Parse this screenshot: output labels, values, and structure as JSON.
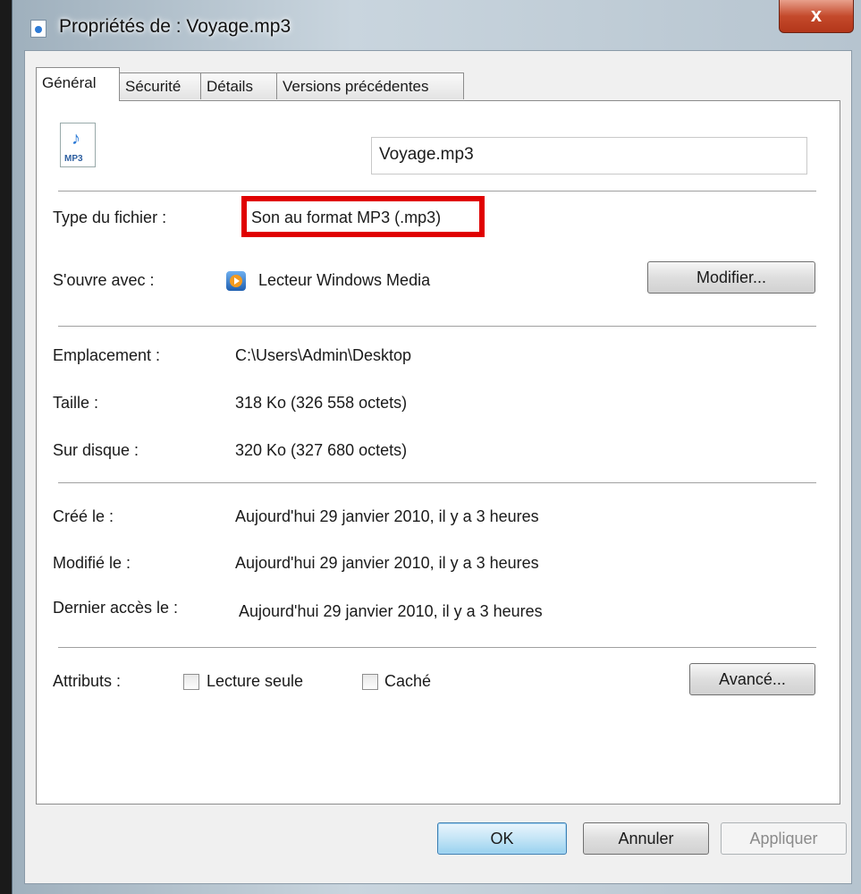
{
  "window": {
    "title": "Propriétés de : Voyage.mp3",
    "close_label": "x"
  },
  "tabs": [
    {
      "label": "Général"
    },
    {
      "label": "Sécurité"
    },
    {
      "label": "Détails"
    },
    {
      "label": "Versions précédentes"
    }
  ],
  "general": {
    "file_icon_label": "MP3",
    "file_name": "Voyage.mp3",
    "type_label": "Type du fichier :",
    "type_value": "Son au format MP3 (.mp3)",
    "opens_with_label": "S'ouvre avec :",
    "opens_with_value": "Lecteur Windows Media",
    "change_button": "Modifier...",
    "location_label": "Emplacement :",
    "location_value": "C:\\Users\\Admin\\Desktop",
    "size_label": "Taille :",
    "size_value": "318 Ko (326 558 octets)",
    "disk_size_label": "Sur disque :",
    "disk_size_value": "320 Ko (327 680 octets)",
    "created_label": "Créé le :",
    "created_value": "Aujourd'hui 29 janvier 2010, il y a 3 heures",
    "modified_label": "Modifié le :",
    "modified_value": "Aujourd'hui 29 janvier 2010, il y a 3 heures",
    "accessed_label": "Dernier accès le :",
    "accessed_value": "Aujourd'hui 29 janvier 2010, il y a 3 heures",
    "attributes_label": "Attributs :",
    "readonly_label": "Lecture seule",
    "hidden_label": "Caché",
    "advanced_button": "Avancé..."
  },
  "footer": {
    "ok": "OK",
    "cancel": "Annuler",
    "apply": "Appliquer"
  },
  "colors": {
    "highlight": "#e00000"
  }
}
